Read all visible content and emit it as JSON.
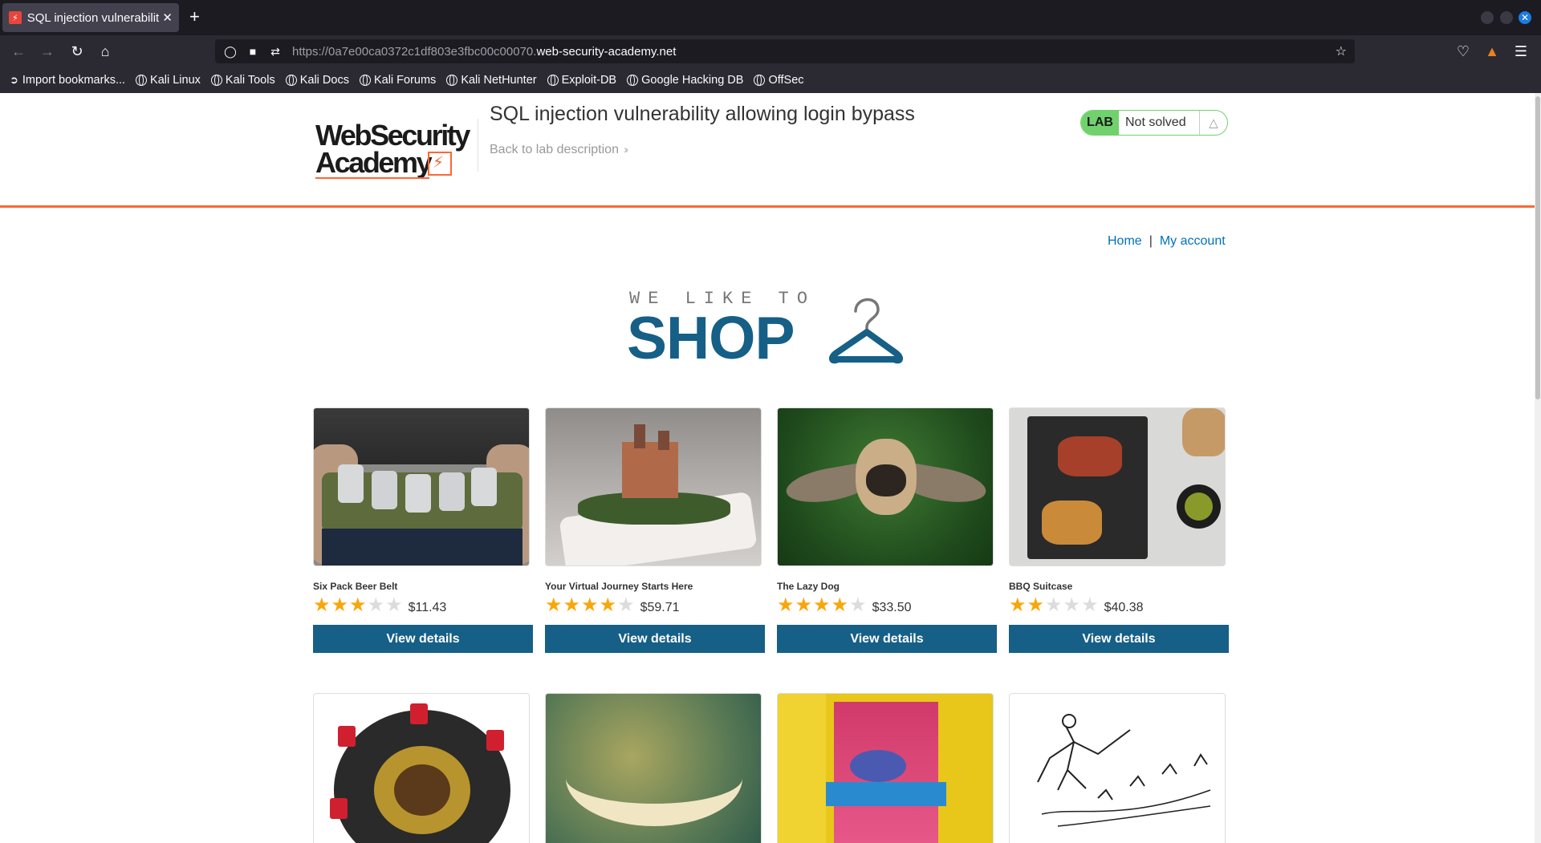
{
  "browser": {
    "tab_title": "SQL injection vulnerabilit",
    "url_prefix": "https://0a7e00ca0372c1df803e3fbc00c00070.",
    "url_domain": "web-security-academy.net",
    "bookmarks": [
      {
        "label": "Import bookmarks..."
      },
      {
        "label": "Kali Linux"
      },
      {
        "label": "Kali Tools"
      },
      {
        "label": "Kali Docs"
      },
      {
        "label": "Kali Forums"
      },
      {
        "label": "Kali NetHunter"
      },
      {
        "label": "Exploit-DB"
      },
      {
        "label": "Google Hacking DB"
      },
      {
        "label": "OffSec"
      }
    ]
  },
  "lab_header": {
    "logo_line1": "WebSecurity",
    "logo_line2": "Academy",
    "title": "SQL injection vulnerability allowing login bypass",
    "back_link": "Back to lab description",
    "status_tag": "LAB",
    "status": "Not solved"
  },
  "nav": {
    "home": "Home",
    "separator": "|",
    "my_account": "My account"
  },
  "hero": {
    "small": "WE LIKE TO",
    "big": "SHOP"
  },
  "products": [
    {
      "name": "Six Pack Beer Belt",
      "rating": 3,
      "price": "$11.43",
      "button": "View details"
    },
    {
      "name": "Your Virtual Journey Starts Here",
      "rating": 4,
      "price": "$59.71",
      "button": "View details"
    },
    {
      "name": "The Lazy Dog",
      "rating": 4,
      "price": "$33.50",
      "button": "View details"
    },
    {
      "name": "BBQ Suitcase",
      "rating": 2,
      "price": "$40.38",
      "button": "View details"
    }
  ],
  "colors": {
    "accent_orange": "#ff6633",
    "brand_blue": "#165f87",
    "link_blue": "#0071bc",
    "star_gold": "#f7a70a",
    "lab_green": "#70d16d"
  }
}
